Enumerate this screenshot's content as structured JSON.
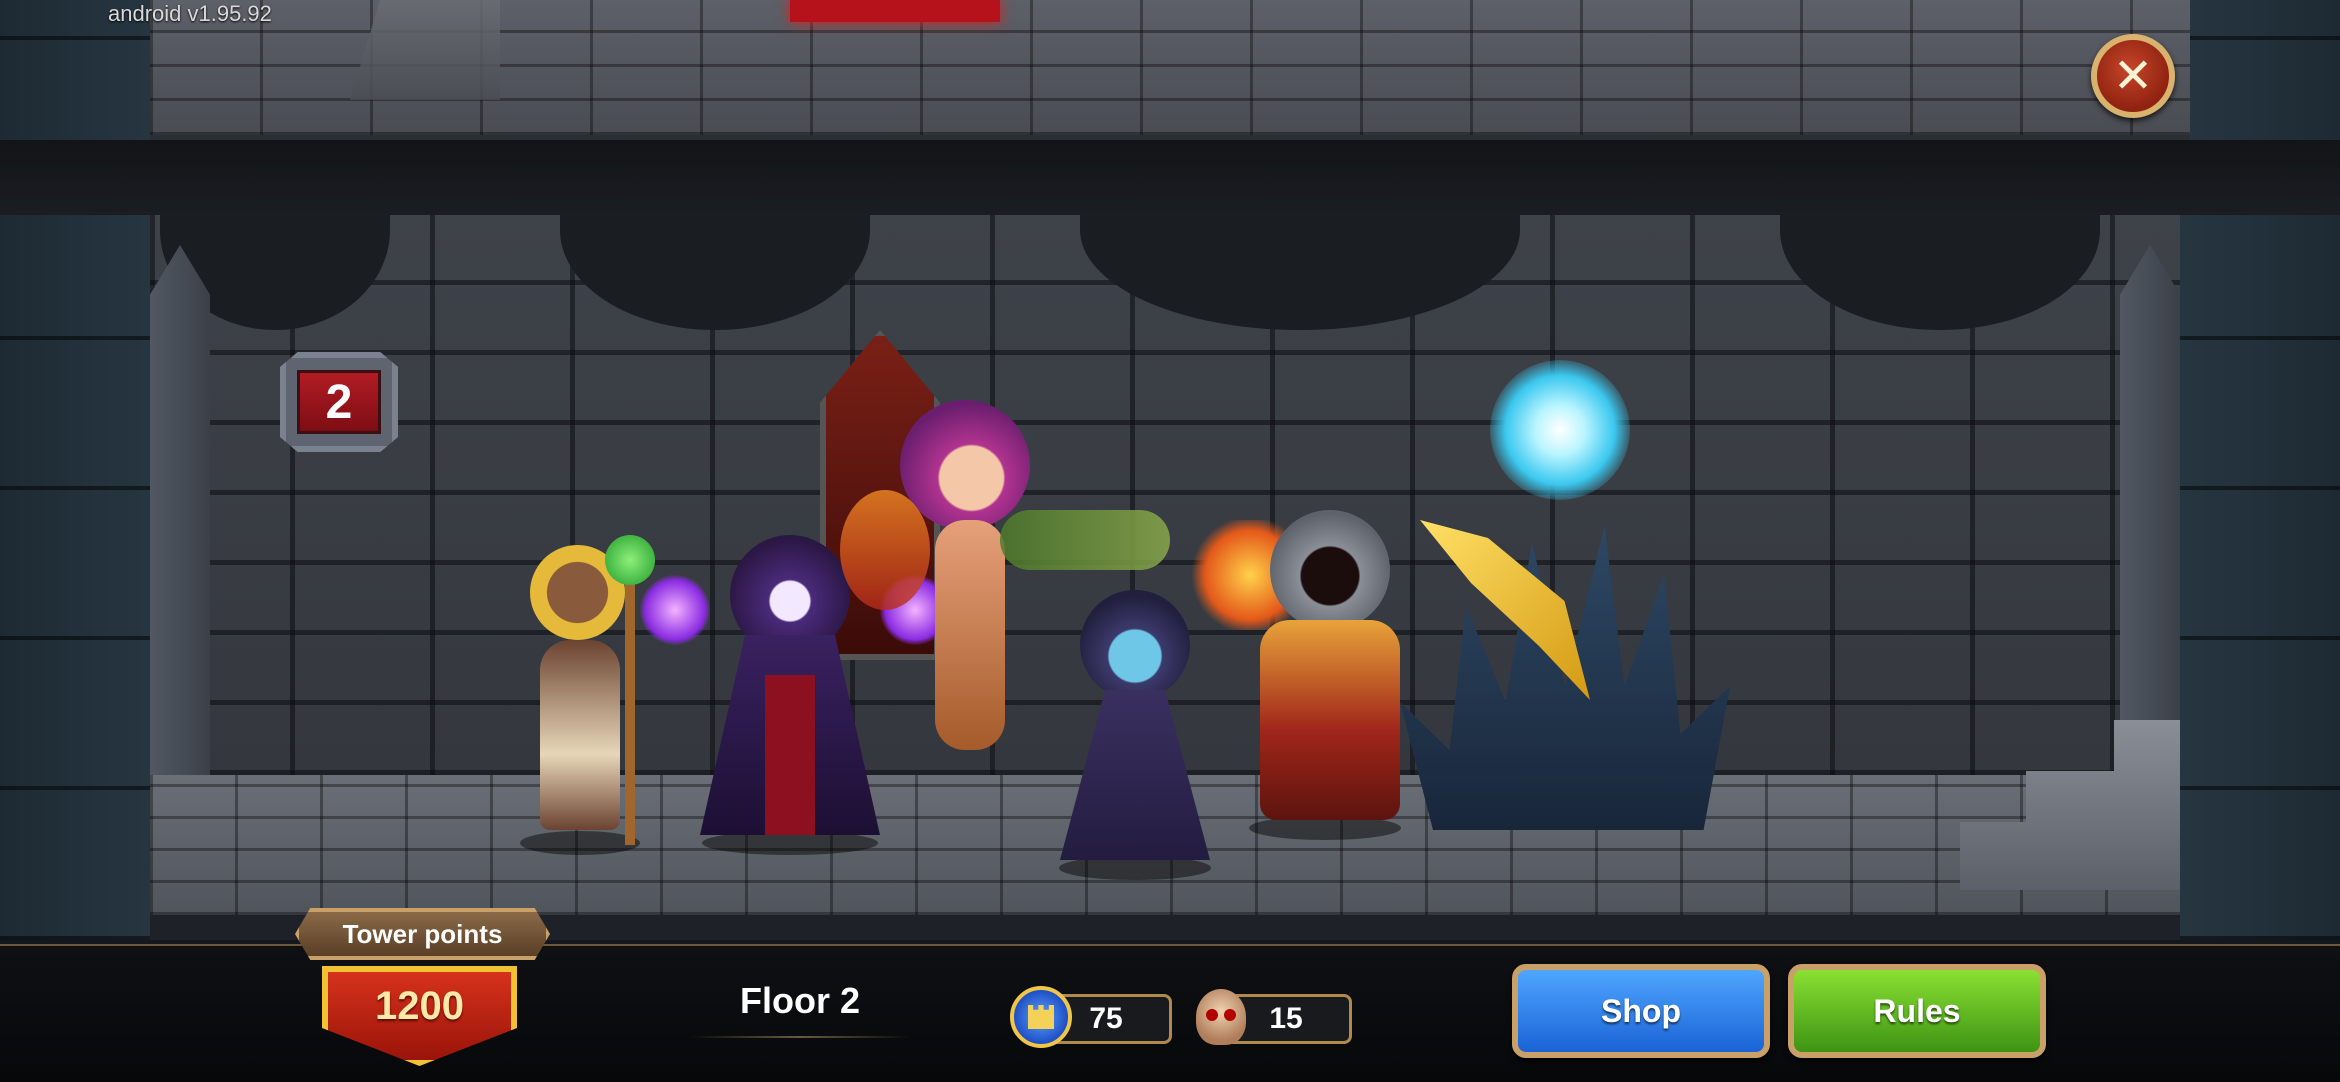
{
  "app": {
    "version": "android v1.95.92"
  },
  "game": {
    "floor_badge": "2",
    "tower_points_label": "Tower points",
    "tower_points_value": "1200",
    "floor_label": "Floor 2",
    "castle_count": "75",
    "skull_count": "15",
    "shop_label": "Shop",
    "rules_label": "Rules"
  },
  "heroes": [
    "fairy-hero",
    "dark-reaper-hero",
    "nature-dryad-hero",
    "ice-wraith-hero",
    "flame-knight-hero"
  ],
  "colors": {
    "shop_button": "#2a7ff0",
    "rules_button": "#5cbc1f",
    "tower_points_shield": "#c52515",
    "frame_gold": "#c9a068"
  },
  "icons": [
    "close-icon",
    "castle-icon",
    "skull-icon"
  ]
}
